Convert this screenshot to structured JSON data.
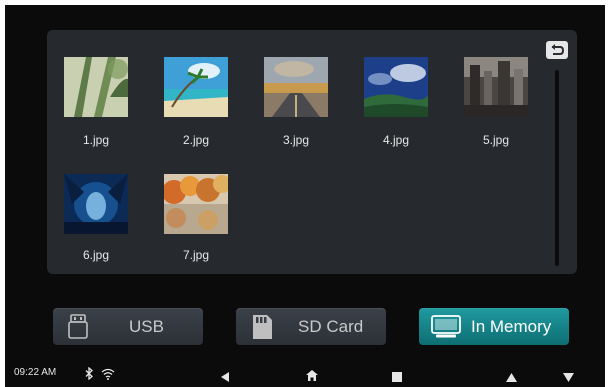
{
  "gallery": {
    "files": [
      {
        "name": "1.jpg"
      },
      {
        "name": "2.jpg"
      },
      {
        "name": "3.jpg"
      },
      {
        "name": "4.jpg"
      },
      {
        "name": "5.jpg"
      },
      {
        "name": "6.jpg"
      },
      {
        "name": "7.jpg"
      }
    ],
    "back_icon": "return-arrow-icon"
  },
  "sources": [
    {
      "label": "USB",
      "icon": "usb-drive-icon",
      "active": false
    },
    {
      "label": "SD Card",
      "icon": "sd-card-icon",
      "active": false
    },
    {
      "label": "In Memory",
      "icon": "monitor-icon",
      "active": true
    }
  ],
  "statusbar": {
    "time": "09:22 AM",
    "icons": [
      "bluetooth-icon",
      "wifi-icon",
      "nav-back-icon",
      "home-icon",
      "recent-apps-icon",
      "volume-up-icon",
      "volume-down-icon"
    ]
  },
  "colors": {
    "panel": "#262a2f",
    "active_button": "#1a8a90",
    "inactive_button": "#363b42"
  }
}
